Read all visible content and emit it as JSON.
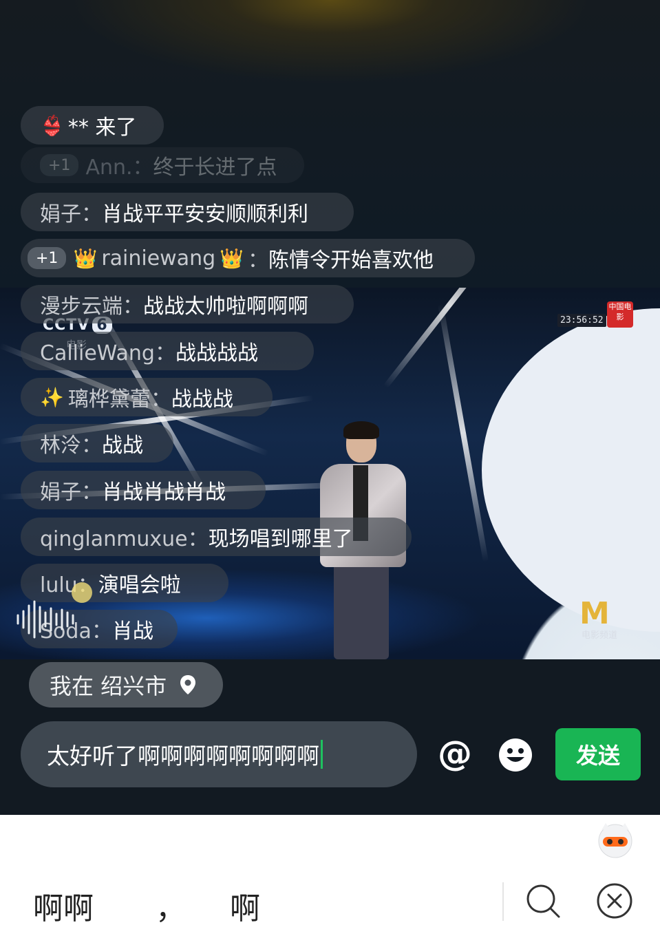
{
  "entry_notice": {
    "text": "** 来了"
  },
  "chat": [
    {
      "badge": "+1",
      "user": "Ann.：",
      "msg": "终于长进了点",
      "faded": true
    },
    {
      "badge": "",
      "user": "娟子：",
      "msg": "肖战平平安安顺顺利利"
    },
    {
      "badge": "+1",
      "user": "rainiewang",
      "msg": "陈情令开始喜欢他"
    },
    {
      "badge": "",
      "user": "漫步云端：",
      "msg": "战战太帅啦啊啊啊"
    },
    {
      "badge": "",
      "user": "CallieWang：",
      "msg": "战战战战"
    },
    {
      "badge": "",
      "user": "璃桦黛蕾：",
      "msg": "战战战"
    },
    {
      "badge": "",
      "user": "林泠：",
      "msg": "战战"
    },
    {
      "badge": "",
      "user": "娟子：",
      "msg": "肖战肖战肖战"
    },
    {
      "badge": "",
      "user": "qinglanmuxue：",
      "msg": "现场唱到哪里了"
    },
    {
      "badge": "",
      "user": "lulu：",
      "msg": "演唱会啦"
    },
    {
      "badge": "",
      "user": "Soda：",
      "msg": "肖战"
    }
  ],
  "video": {
    "channel": "CCTV",
    "channel_num": "6",
    "channel_sub": "电影",
    "clock": "23:56:52",
    "stamp": "中国电影",
    "corner_logo": "M",
    "corner_sub": "电影频道"
  },
  "location": {
    "label": "我在 绍兴市"
  },
  "input": {
    "value": "太好听了啊啊啊啊啊啊啊啊"
  },
  "send_label": "发送",
  "at_symbol": "@",
  "keyboard": {
    "candidates": [
      "啊啊",
      "，",
      "啊"
    ]
  },
  "colors": {
    "send": "#19b554",
    "cursor": "#1ec15f"
  }
}
